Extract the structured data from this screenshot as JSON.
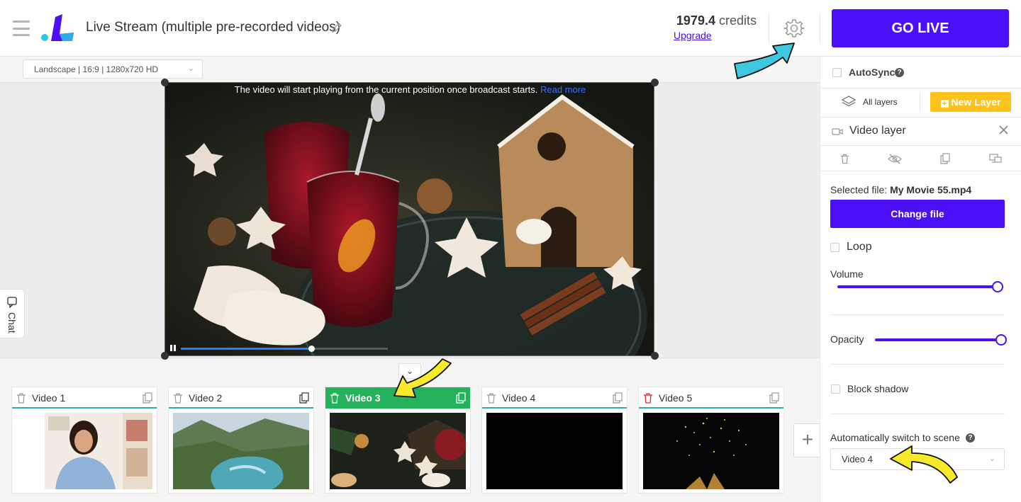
{
  "header": {
    "title": "Live Stream (multiple pre-recorded videos)",
    "credits_value": "1979.4",
    "credits_unit": "credits",
    "upgrade_label": "Upgrade",
    "go_live_label": "GO LIVE"
  },
  "canvas": {
    "resolution": "Landscape | 16:9 | 1280x720 HD",
    "notice_text": "The video will start playing from the current position once broadcast starts.",
    "notice_link": "Read more",
    "playback_progress": 0.63
  },
  "chat": {
    "label": "Chat"
  },
  "scenes": [
    {
      "name": "Video 1",
      "active": false
    },
    {
      "name": "Video 2",
      "active": false
    },
    {
      "name": "Video 3",
      "active": true
    },
    {
      "name": "Video 4",
      "active": false
    },
    {
      "name": "Video 5",
      "active": false
    }
  ],
  "panel": {
    "autosync_label": "AutoSync",
    "all_layers_label": "All layers",
    "new_layer_label": "New Layer",
    "layer_title": "Video layer",
    "selected_file_prefix": "Selected file:",
    "selected_file_name": "My Movie 55.mp4",
    "change_file_label": "Change file",
    "loop_label": "Loop",
    "volume_label": "Volume",
    "volume_value": 1.0,
    "opacity_label": "Opacity",
    "opacity_value": 1.0,
    "block_shadow_label": "Block shadow",
    "auto_switch_label": "Automatically switch to scene",
    "auto_switch_value": "Video 4"
  },
  "colors": {
    "accent": "#4b10f5",
    "new_layer": "#ffc21a",
    "active_scene": "#24b25c",
    "annotation_cyan": "#3ec8e0",
    "annotation_yellow": "#f7ea2a"
  },
  "icons": [
    "hamburger-icon",
    "pencil-icon",
    "gear-icon",
    "layers-icon",
    "plus-icon",
    "camera-icon",
    "close-icon",
    "trash-icon",
    "eye-off-icon",
    "copy-icon",
    "screen-icon",
    "help-icon",
    "chevron-down-icon",
    "pause-icon"
  ]
}
